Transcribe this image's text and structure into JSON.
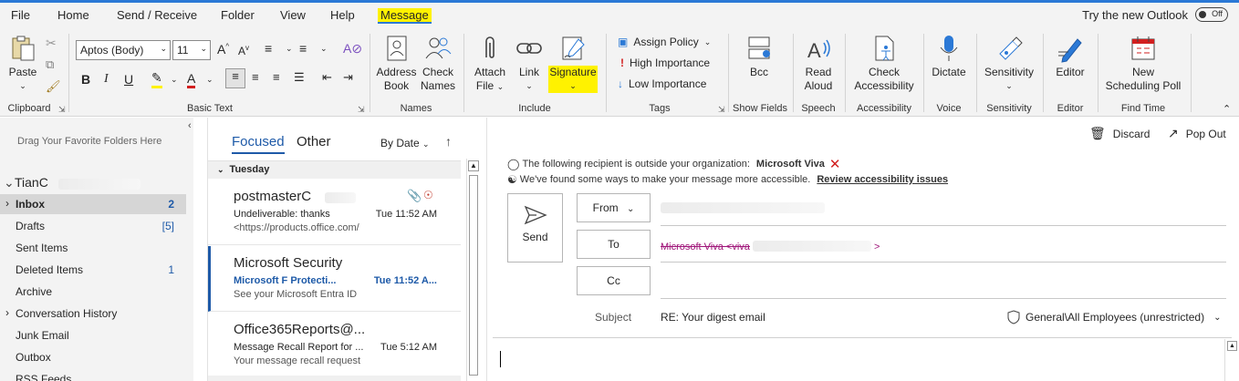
{
  "menu": {
    "tabs": [
      "File",
      "Home",
      "Send / Receive",
      "Folder",
      "View",
      "Help",
      "Message"
    ],
    "active_tab": "Message",
    "try_new": "Try the new Outlook",
    "toggle_state": "Off"
  },
  "ribbon": {
    "clipboard": {
      "paste": "Paste",
      "label": "Clipboard"
    },
    "basic_text": {
      "font": "Aptos (Body)",
      "size": "11",
      "label": "Basic Text"
    },
    "names": {
      "address_book_1": "Address",
      "address_book_2": "Book",
      "check_names_1": "Check",
      "check_names_2": "Names",
      "label": "Names"
    },
    "include": {
      "attach_1": "Attach",
      "attach_2": "File",
      "link": "Link",
      "signature": "Signature",
      "label": "Include"
    },
    "tags": {
      "assign_policy": "Assign Policy",
      "high": "High Importance",
      "low": "Low Importance",
      "label": "Tags"
    },
    "show_fields": {
      "bcc": "Bcc",
      "label": "Show Fields"
    },
    "speech": {
      "read_1": "Read",
      "read_2": "Aloud",
      "label": "Speech"
    },
    "accessibility": {
      "check_1": "Check",
      "check_2": "Accessibility",
      "label": "Accessibility"
    },
    "voice": {
      "dictate": "Dictate",
      "label": "Voice"
    },
    "sensitivity": {
      "btn": "Sensitivity",
      "label": "Sensitivity"
    },
    "editor": {
      "btn": "Editor",
      "label": "Editor"
    },
    "find_time": {
      "btn_1": "New",
      "btn_2": "Scheduling Poll",
      "label": "Find Time"
    }
  },
  "folders": {
    "fav_hint": "Drag Your Favorite Folders Here",
    "account": "TianC",
    "items": [
      {
        "label": "Inbox",
        "count": "2"
      },
      {
        "label": "Drafts",
        "count": "[5]"
      },
      {
        "label": "Sent Items",
        "count": ""
      },
      {
        "label": "Deleted Items",
        "count": "1"
      },
      {
        "label": "Archive",
        "count": ""
      },
      {
        "label": "Conversation History",
        "count": ""
      },
      {
        "label": "Junk Email",
        "count": ""
      },
      {
        "label": "Outbox",
        "count": ""
      },
      {
        "label": "RSS Feeds",
        "count": ""
      }
    ]
  },
  "message_list": {
    "tab_focused": "Focused",
    "tab_other": "Other",
    "sort": "By Date",
    "group": "Tuesday",
    "messages": [
      {
        "sender": "postmasterC",
        "subject": "Undeliverable: thanks",
        "time": "Tue 11:52 AM",
        "preview": "<https://products.office.com/"
      },
      {
        "sender": "Microsoft Security",
        "subject": "Microsoft F      Protecti...",
        "time": "Tue 11:52 A...",
        "preview": "See your Microsoft Entra ID"
      },
      {
        "sender": "Office365Reports@...",
        "subject": "Message Recall Report for ...",
        "time": "Tue 5:12 AM",
        "preview": "Your message recall request"
      }
    ]
  },
  "compose": {
    "discard": "Discard",
    "popout": "Pop Out",
    "notice_outside": "The following recipient is outside your organization:",
    "notice_name": "Microsoft Viva",
    "notice_access": "We've found some ways to make your message more accessible.",
    "notice_link": "Review accessibility issues",
    "send": "Send",
    "from": "From",
    "to": "To",
    "cc": "Cc",
    "to_value": "Microsoft Viva <viva",
    "to_suffix": ">",
    "subject_label": "Subject",
    "subject_value": "RE: Your digest email",
    "sensitivity": "General\\All Employees (unrestricted)"
  },
  "colors": {
    "accent": "#1e5aa8",
    "highlight": "#fff200",
    "ribbon_bg": "#f3f3f3",
    "recipient": "#a0177a"
  }
}
